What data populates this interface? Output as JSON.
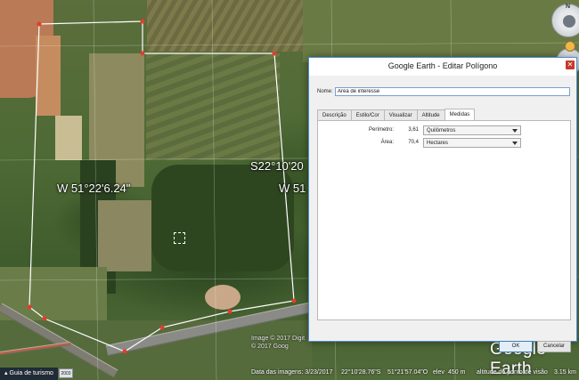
{
  "map": {
    "labels": {
      "lon_grid_left": "W 51°22'6.24\"",
      "lat_grid": "S22°10'20",
      "lon_grid_right": "W 51"
    },
    "copyright": "Image © 2017 Digit\n© 2017 Goog",
    "logo": "Google Earth",
    "vertex_color": "#e53b2c",
    "outline_color": "#ffffff"
  },
  "nav": {
    "north_label": "N"
  },
  "statusbar": {
    "guide_tab": "Guia de turismo",
    "thumbnail": "2003",
    "imagery_date": "Data das imagens: 3/23/2017",
    "lat": "22°10'28.76\"S",
    "lon": "51°21'57.04\"O",
    "elev_label": "elev",
    "elev_value": "450 m",
    "alt_label": "altitude do ponto de visão",
    "alt_value": "3.15 km"
  },
  "dialog": {
    "title": "Google Earth - Editar Polígono",
    "close_icon": "close-icon",
    "name_label": "Nome:",
    "name_value": "Área de interesse",
    "tabs": [
      {
        "label": "Descrição"
      },
      {
        "label": "Estilo/Cor"
      },
      {
        "label": "Visualizar"
      },
      {
        "label": "Altitude"
      },
      {
        "label": "Medidas"
      }
    ],
    "active_tab": "Medidas",
    "measurements": {
      "perimeter_label": "Perímetro:",
      "perimeter_value": "3,61",
      "perimeter_unit": "Quilômetros",
      "area_label": "Área:",
      "area_value": "70,4",
      "area_unit": "Hectares"
    },
    "ok_label": "OK",
    "cancel_label": "Cancelar"
  }
}
